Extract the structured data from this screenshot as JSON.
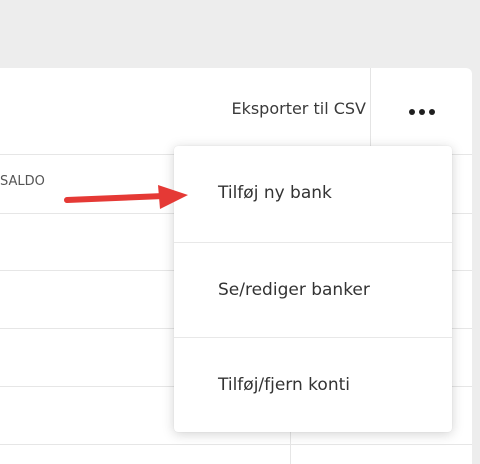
{
  "toolbar": {
    "export_label": "Eksporter til CSV",
    "more_icon": "more-horizontal-icon"
  },
  "table": {
    "columns": [
      "SALDO"
    ]
  },
  "menu": {
    "items": [
      {
        "label": "Tilføj ny bank"
      },
      {
        "label": "Se/rediger banker"
      },
      {
        "label": "Tilføj/fjern konti"
      }
    ]
  },
  "annotation": {
    "icon": "arrow-right-icon",
    "color": "#e53935"
  },
  "colors": {
    "background": "#ededed",
    "card": "#ffffff",
    "divider": "#e6e6e6",
    "text": "#333333"
  }
}
